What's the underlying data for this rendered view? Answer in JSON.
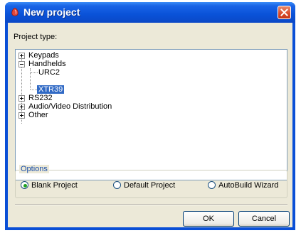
{
  "window": {
    "title": "New project",
    "accent": "#0a52d8"
  },
  "project_type": {
    "label": "Project type:",
    "tree": [
      {
        "label": "Keypads",
        "expanded": false
      },
      {
        "label": "Handhelds",
        "expanded": true,
        "children": [
          "URC2",
          "XTR39"
        ]
      },
      {
        "label": "RS232",
        "expanded": false
      },
      {
        "label": "Audio/Video Distribution",
        "expanded": false
      },
      {
        "label": "Other",
        "expanded": false
      }
    ],
    "selected": "XTR39"
  },
  "options": {
    "title": "Options",
    "radios": [
      {
        "label": "Blank Project",
        "checked": true
      },
      {
        "label": "Default Project",
        "checked": false
      },
      {
        "label": "AutoBuild Wizard",
        "checked": false
      }
    ]
  },
  "buttons": {
    "ok": "OK",
    "cancel": "Cancel"
  },
  "icons": {
    "app": "app-icon",
    "close": "close-icon",
    "expand": "plus-icon",
    "collapse": "minus-icon"
  }
}
